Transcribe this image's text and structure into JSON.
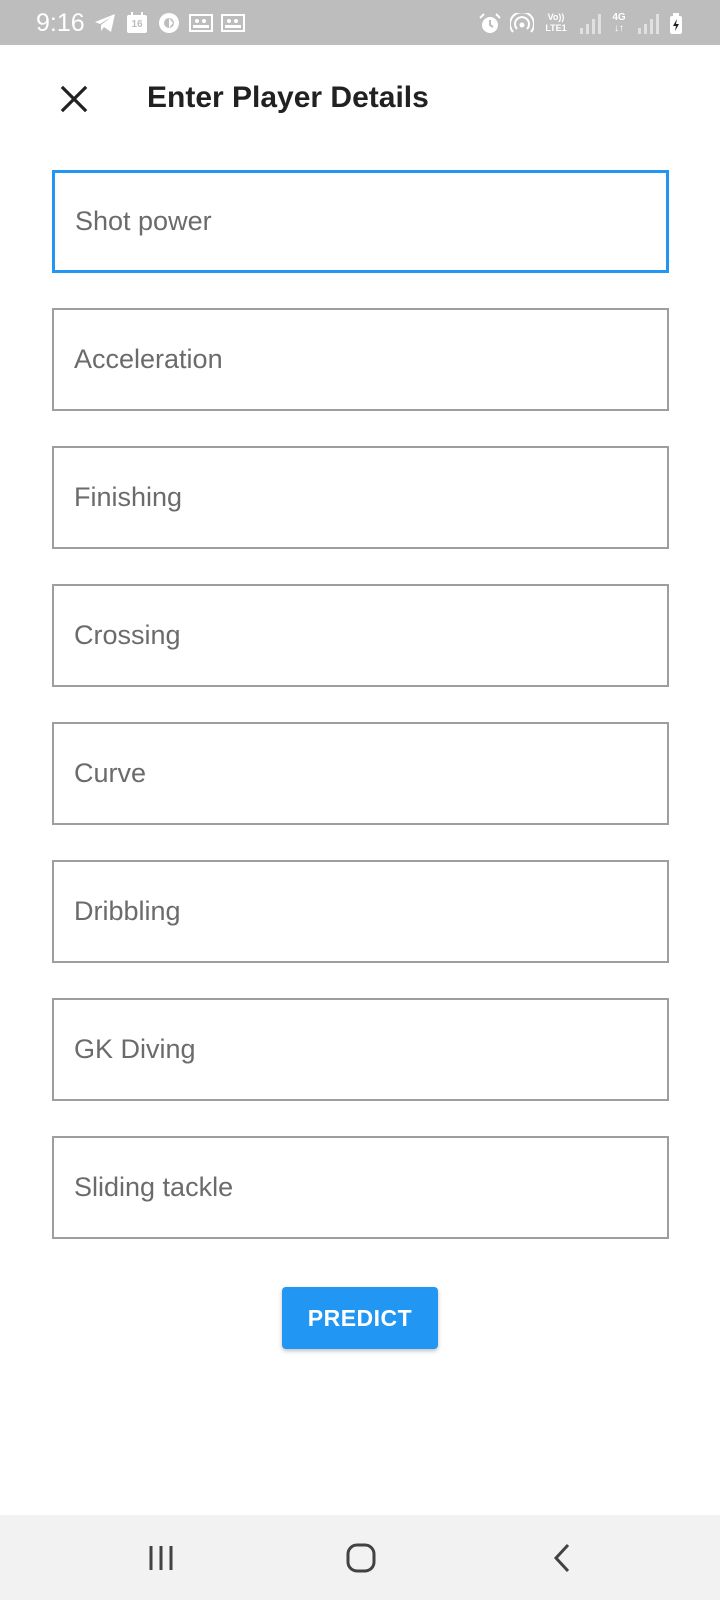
{
  "status_bar": {
    "time": "9:16",
    "left_icons": [
      "telegram-icon",
      "calendar-icon",
      "app-icon",
      "gallery-icon",
      "gallery-icon"
    ],
    "calendar_day": "16",
    "right_icons": [
      "alarm-icon",
      "hotspot-icon",
      "volte-icon",
      "signal-icon",
      "4g-icon",
      "signal-icon",
      "battery-charging-icon"
    ],
    "volte_label_top": "Vo))",
    "volte_label_bottom": "LTE1",
    "network_label": "4G"
  },
  "app_bar": {
    "title": "Enter Player Details",
    "close_icon": "close-icon"
  },
  "form": {
    "fields": [
      {
        "placeholder": "Shot power",
        "value": "",
        "focused": true
      },
      {
        "placeholder": "Acceleration",
        "value": ""
      },
      {
        "placeholder": "Finishing",
        "value": ""
      },
      {
        "placeholder": "Crossing",
        "value": ""
      },
      {
        "placeholder": "Curve",
        "value": ""
      },
      {
        "placeholder": "Dribbling",
        "value": ""
      },
      {
        "placeholder": "GK Diving",
        "value": ""
      },
      {
        "placeholder": "Sliding tackle",
        "value": ""
      }
    ],
    "submit_label": "PREDICT"
  },
  "nav_bar": {
    "buttons": [
      "recent-apps-icon",
      "home-icon",
      "back-icon"
    ]
  },
  "colors": {
    "accent": "#2196f3",
    "status_bar_bg": "#bdbdbd",
    "field_border": "#9e9e9e",
    "placeholder_text": "#6b6b6b",
    "title_text": "#212121",
    "nav_bar_bg": "#f2f2f2"
  }
}
